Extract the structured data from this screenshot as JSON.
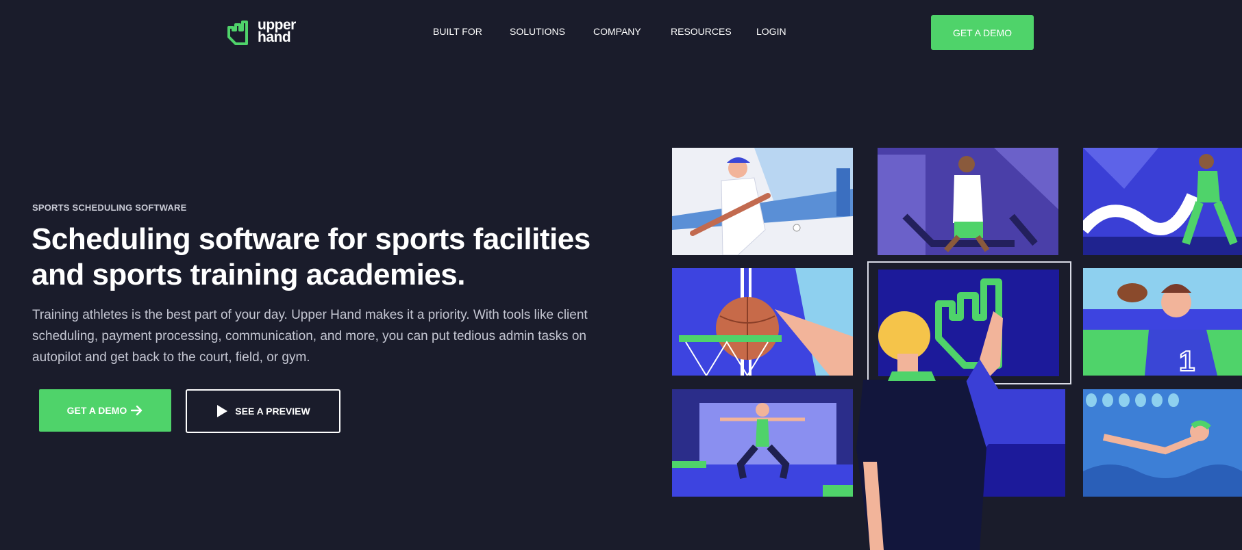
{
  "brand": {
    "logo_line1": "upper",
    "logo_line2": "hand",
    "accent": "#4fd36a",
    "background": "#1a1c2b"
  },
  "nav": {
    "items": [
      {
        "label": "BUILT FOR"
      },
      {
        "label": "SOLUTIONS"
      },
      {
        "label": "COMPANY"
      },
      {
        "label": "RESOURCES"
      },
      {
        "label": "LOGIN"
      }
    ],
    "cta_label": "GET A DEMO"
  },
  "hero": {
    "eyebrow": "SPORTS SCHEDULING SOFTWARE",
    "headline_line1": "Scheduling software for sports facilities",
    "headline_line2": "and sports training academies.",
    "body": "Training athletes is the best part of your day. Upper Hand makes it a priority. With tools like client scheduling, payment processing, communication, and more, you can put tedious admin tasks on autopilot and get back to the court, field, or gym.",
    "primary_cta": {
      "label": "GET A DEMO",
      "icon": "arrow-right-icon"
    },
    "secondary_cta": {
      "label": "SEE A PREVIEW",
      "icon": "play-icon"
    }
  },
  "illustration": {
    "tiles": [
      "baseball",
      "treadmill-runner",
      "battle-ropes",
      "basketball",
      "upper-hand-logo-screen",
      "football",
      "yoga",
      "swimmer"
    ],
    "jersey_number": "1"
  }
}
